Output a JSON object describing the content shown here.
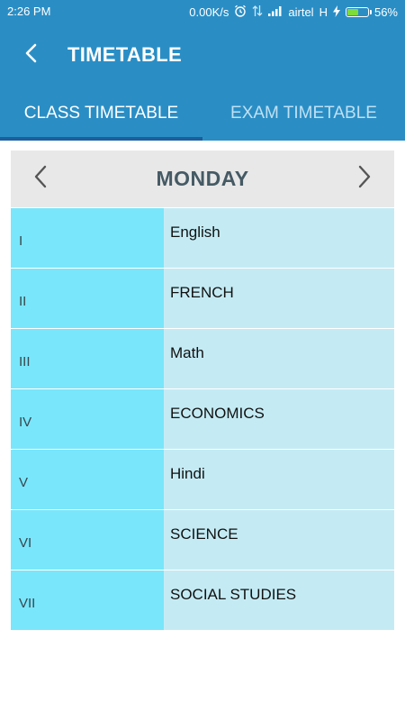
{
  "status_bar": {
    "time": "2:26 PM",
    "network_speed": "0.00K/s",
    "carrier": "airtel",
    "network_type": "H",
    "battery": "56%",
    "battery_level": 0.56,
    "colors": {
      "background": "#2a8ec5",
      "battery_fill": "#7ddc3a"
    },
    "icons": [
      "alarm-icon",
      "data-transfer-icon",
      "signal-icon",
      "charging-icon",
      "battery-icon"
    ]
  },
  "app_bar": {
    "title": "TIMETABLE",
    "back_icon": "back-arrow-icon",
    "color": "#2a8ec5"
  },
  "tabs": [
    {
      "label": "CLASS TIMETABLE",
      "active": true
    },
    {
      "label": "EXAM TIMETABLE",
      "active": false
    }
  ],
  "day_nav": {
    "day": "MONDAY",
    "prev_icon": "chevron-left-icon",
    "next_icon": "chevron-right-icon"
  },
  "timetable": [
    {
      "period": "I",
      "subject": "English"
    },
    {
      "period": "II",
      "subject": "FRENCH"
    },
    {
      "period": "III",
      "subject": "Math"
    },
    {
      "period": "IV",
      "subject": "ECONOMICS"
    },
    {
      "period": "V",
      "subject": "Hindi"
    },
    {
      "period": "VI",
      "subject": "SCIENCE"
    },
    {
      "period": "VII",
      "subject": "SOCIAL STUDIES"
    }
  ],
  "colors": {
    "period_cell": "#79e6fb",
    "subject_cell": "#c4ebf4",
    "tab_indicator": "#1a5f9e"
  }
}
